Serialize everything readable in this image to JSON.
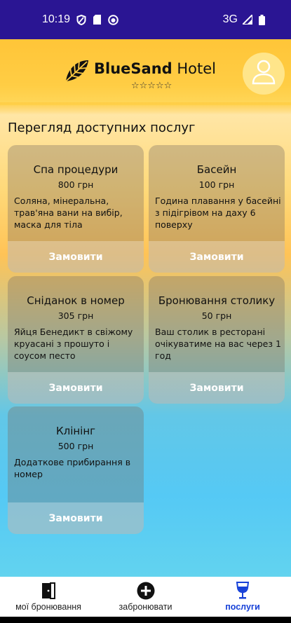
{
  "status": {
    "time": "10:19",
    "network": "3G"
  },
  "header": {
    "brand_blue": "Blue",
    "brand_sand": "Sand",
    "brand_hotel": " Hotel",
    "stars": "☆☆☆☆☆"
  },
  "page": {
    "title": "Перегляд доступних послуг"
  },
  "services": [
    {
      "title": "Спа процедури",
      "price": "800 грн",
      "desc": "Соляна, мінеральна, трав'яна вани на вибір, маска для тіла",
      "button": "Замовити"
    },
    {
      "title": "Басейн",
      "price": "100 грн",
      "desc": "Година плавання у басейні з підігрівом на даху 6 поверху",
      "button": "Замовити"
    },
    {
      "title": "Сніданок в номер",
      "price": "305 грн",
      "desc": "Яйця Бенедикт в свіжому круасані з прошуто і соусом песто",
      "button": "Замовити"
    },
    {
      "title": "Бронювання столику",
      "price": "50 грн",
      "desc": "Ваш столик в ресторані очікуватиме на вас  через 1 год",
      "button": "Замовити"
    },
    {
      "title": "Клінінг",
      "price": "500 грн",
      "desc": "Додаткове прибирання в номер",
      "button": "Замовити"
    }
  ],
  "nav": {
    "items": [
      {
        "label": "мої бронювання",
        "icon": "door-icon",
        "active": false
      },
      {
        "label": "забронювати",
        "icon": "add-circle-icon",
        "active": false
      },
      {
        "label": "послуги",
        "icon": "wine-glass-icon",
        "active": true
      }
    ]
  },
  "colors": {
    "status_bar": "#2a1593",
    "accent": "#1741d8",
    "header": "#ffc538"
  }
}
